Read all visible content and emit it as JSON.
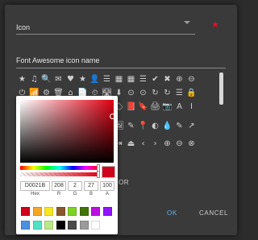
{
  "icon_field": {
    "label": "Icon",
    "required_mark": "★"
  },
  "name_field": {
    "label": "Font Awesome icon name"
  },
  "color_field": {
    "label_fragment": "OR"
  },
  "icon_rows": [
    [
      "★",
      "♫",
      "🔍",
      "✉",
      "♥",
      "★",
      "👤",
      "☰",
      "▦",
      "▦",
      "☰",
      "✔",
      "✖",
      "⊕",
      "⊖"
    ],
    [
      "⏻",
      "📶",
      "⚙",
      "🗑",
      "⌂",
      "📄",
      "⏲",
      "🛣",
      "⬇",
      "⊙",
      "⊙",
      "↻",
      "↻",
      "☰",
      "🔒"
    ],
    [
      "⚑",
      "🎧",
      "🔈",
      "🔉",
      "🔊",
      "▦",
      "▥",
      "🏷",
      "🏷",
      "📕",
      "🔖",
      "🖨",
      "📷",
      "A",
      "I"
    ],
    [
      "☰",
      "☰",
      "☰",
      "☰",
      "☰",
      "☰",
      "☰",
      "🎥",
      "🖼",
      "✎",
      "📍",
      "◐",
      "💧",
      "✎",
      "↗"
    ],
    [
      "⇤",
      "⏮",
      "⏪",
      "▶",
      "⏸",
      "⏹",
      "⏩",
      "⏭",
      "⇥",
      "⏏",
      "‹",
      "›",
      "⊕",
      "⊖",
      "⊗"
    ]
  ],
  "picker": {
    "hex": "D0021B",
    "r": "208",
    "g": "2",
    "b": "27",
    "a": "100",
    "labels": {
      "hex": "Hex",
      "r": "R",
      "g": "G",
      "b": "B",
      "a": "A"
    },
    "selected_color": "#D0021B",
    "swatches": [
      "#D0021B",
      "#F5A623",
      "#F8E71C",
      "#8B572A",
      "#7ED321",
      "#417505",
      "#BD10E0",
      "#9013FE",
      "#4A90E2",
      "#50E3C2",
      "#B8E986",
      "#000000",
      "#4A4A4A",
      "#9B9B9B",
      "#FFFFFF"
    ]
  },
  "buttons": {
    "ok": "OK",
    "cancel": "CANCEL"
  }
}
